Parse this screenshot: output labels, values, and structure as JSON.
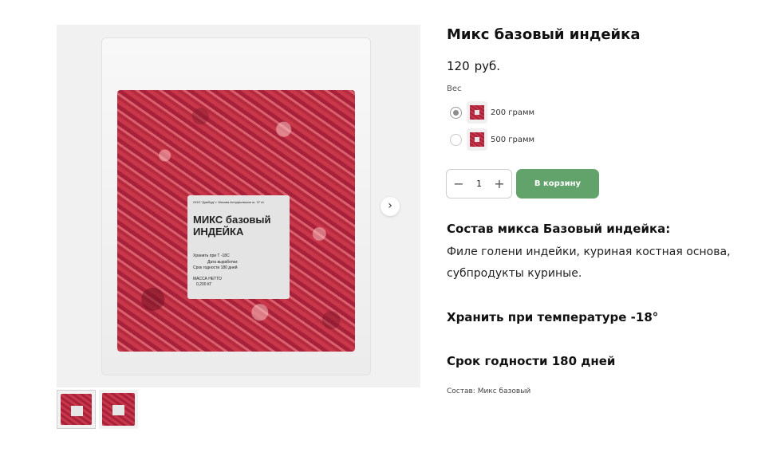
{
  "product": {
    "title": "Микс базовый индейка",
    "price_value": "120",
    "price_currency": "руб."
  },
  "image_label": {
    "company_line": "ООО \"ДикФуд\"   г. Москва Алтуфьевское ш. 37 к1",
    "name": "МИКС  базовый ИНДЕЙКА",
    "storage": "Хранить при Т -18С",
    "production_date": "Дата выработки:",
    "shelf_life": "Срок годности 180 дней",
    "mass_label": "МАССА НЕТТО",
    "mass_value": "0,200    КГ"
  },
  "variant": {
    "label": "Вес",
    "options": [
      {
        "text": "200 грамм",
        "selected": true
      },
      {
        "text": "500 грамм",
        "selected": false
      }
    ]
  },
  "cart": {
    "quantity": "1",
    "minus_icon": "minus-icon",
    "plus_icon": "plus-icon",
    "button_label": "В корзину",
    "button_color": "#62a36c"
  },
  "description": {
    "composition_title": "Состав микса Базовый индейка:",
    "composition_text": "Филе голени индейки, куриная костная основа, субпродукты куриные.",
    "storage": "Хранить при температуре -18°",
    "shelf_life": "Срок годности 180 дней",
    "composition_small": "Состав: Микс базовый"
  },
  "gallery": {
    "next_icon": "chevron-right-icon",
    "next_glyph": "›"
  }
}
